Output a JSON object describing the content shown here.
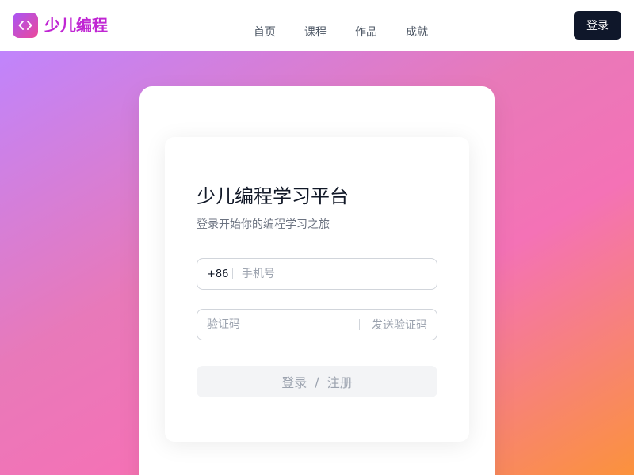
{
  "header": {
    "brand": "少儿编程",
    "nav": [
      {
        "label": "首页"
      },
      {
        "label": "课程"
      },
      {
        "label": "作品"
      },
      {
        "label": "成就"
      }
    ],
    "login_label": "登录"
  },
  "login_card": {
    "title": "少儿编程学习平台",
    "subtitle": "登录开始你的编程学习之旅",
    "phone": {
      "prefix": "+86",
      "placeholder": "手机号",
      "value": ""
    },
    "code": {
      "placeholder": "验证码",
      "value": "",
      "send_label": "发送验证码"
    },
    "submit": {
      "login": "登录",
      "separator": "/",
      "register": "注册"
    }
  },
  "colors": {
    "brand_gradient_start": "#a855f7",
    "brand_gradient_end": "#ec4899",
    "brand_text": "#c026d3",
    "header_button_bg": "#0f172a",
    "bg_gradient": [
      "#c084fc",
      "#f472b6",
      "#fb923c"
    ]
  },
  "icons": {
    "logo": "code-brackets-icon"
  }
}
